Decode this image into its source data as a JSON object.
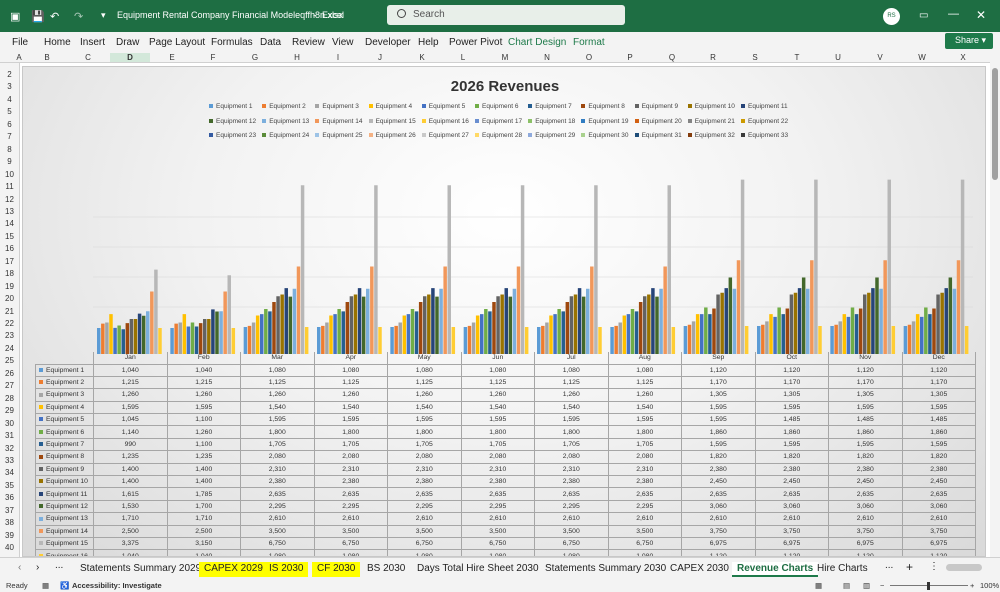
{
  "titlebar": {
    "file_name": "Equipment Rental Company Financial Modeleqffh8n.xlsx",
    "app_name": "Excel",
    "search_placeholder": "Search",
    "user_initials": "RS",
    "ribbon_display_icon": "ribbon-display-options-icon",
    "minimize_icon": "minimize-icon",
    "restore_icon": "restore-icon",
    "close_icon": "close-icon"
  },
  "menu": {
    "items": [
      "File",
      "Home",
      "Insert",
      "Draw",
      "Page Layout",
      "Formulas",
      "Data",
      "Review",
      "View",
      "Developer",
      "Help",
      "Power Pivot"
    ],
    "context_items": [
      "Chart Design",
      "Format"
    ],
    "share_label": "Share"
  },
  "columns": [
    "A",
    "B",
    "C",
    "D",
    "E",
    "F",
    "G",
    "H",
    "I",
    "J",
    "K",
    "L",
    "M",
    "N",
    "O",
    "P",
    "Q",
    "R",
    "S",
    "T",
    "U",
    "V",
    "W",
    "X"
  ],
  "rows": [
    "2",
    "3",
    "4",
    "5",
    "6",
    "7",
    "8",
    "9",
    "10",
    "11",
    "12",
    "13",
    "14",
    "15",
    "16",
    "17",
    "18",
    "19",
    "20",
    "21",
    "22",
    "23",
    "24",
    "25",
    "26",
    "27",
    "28",
    "29",
    "30",
    "31",
    "32",
    "33",
    "34",
    "35",
    "36",
    "37",
    "38",
    "39",
    "40"
  ],
  "chart_data": {
    "type": "bar",
    "title": "2026 Revenues",
    "legend_position": "top",
    "categories": [
      "Jan",
      "Feb",
      "Mar",
      "Apr",
      "May",
      "Jun",
      "Jul",
      "Aug",
      "Sep",
      "Oct",
      "Nov",
      "Dec"
    ],
    "series_colors": [
      "#5b9bd5",
      "#ed7d31",
      "#a5a5a5",
      "#ffc000",
      "#4472c4",
      "#70ad47",
      "#255e91",
      "#9e480e",
      "#636363",
      "#997300",
      "#264478",
      "#43682b",
      "#7cafdd",
      "#f1975a",
      "#b7b7b7",
      "#ffcd33",
      "#698ed0",
      "#8cc168",
      "#327dc2",
      "#d26012",
      "#848484",
      "#cc9a00",
      "#335aa1",
      "#5a8b39",
      "#9dc3e6",
      "#f4b183",
      "#c9c9c9",
      "#ffd966",
      "#8faadc",
      "#a9d18e",
      "#1f4e79",
      "#843c0c",
      "#3a3a3a"
    ],
    "series": [
      {
        "name": "Equipment 1",
        "values": [
          1040,
          1040,
          1080,
          1080,
          1080,
          1080,
          1080,
          1080,
          1120,
          1120,
          1120,
          1120
        ]
      },
      {
        "name": "Equipment 2",
        "values": [
          1215,
          1215,
          1125,
          1125,
          1125,
          1125,
          1125,
          1125,
          1170,
          1170,
          1170,
          1170
        ]
      },
      {
        "name": "Equipment 3",
        "values": [
          1260,
          1260,
          1260,
          1260,
          1260,
          1260,
          1260,
          1260,
          1305,
          1305,
          1305,
          1305
        ]
      },
      {
        "name": "Equipment 4",
        "values": [
          1595,
          1595,
          1540,
          1540,
          1540,
          1540,
          1540,
          1540,
          1595,
          1595,
          1595,
          1595
        ]
      },
      {
        "name": "Equipment 5",
        "values": [
          1045,
          1100,
          1595,
          1595,
          1595,
          1595,
          1595,
          1595,
          1595,
          1485,
          1485,
          1485
        ]
      },
      {
        "name": "Equipment 6",
        "values": [
          1140,
          1260,
          1800,
          1800,
          1800,
          1800,
          1800,
          1800,
          1860,
          1860,
          1860,
          1860
        ]
      },
      {
        "name": "Equipment 7",
        "values": [
          990,
          1100,
          1705,
          1705,
          1705,
          1705,
          1705,
          1705,
          1595,
          1595,
          1595,
          1595
        ]
      },
      {
        "name": "Equipment 8",
        "values": [
          1235,
          1235,
          2080,
          2080,
          2080,
          2080,
          2080,
          2080,
          1820,
          1820,
          1820,
          1820
        ]
      },
      {
        "name": "Equipment 9",
        "values": [
          1400,
          1400,
          2310,
          2310,
          2310,
          2310,
          2310,
          2310,
          2380,
          2380,
          2380,
          2380
        ]
      },
      {
        "name": "Equipment 10",
        "values": [
          1400,
          1400,
          2380,
          2380,
          2380,
          2380,
          2380,
          2380,
          2450,
          2450,
          2450,
          2450
        ]
      },
      {
        "name": "Equipment 11",
        "values": [
          1615,
          1785,
          2635,
          2635,
          2635,
          2635,
          2635,
          2635,
          2635,
          2635,
          2635,
          2635
        ]
      },
      {
        "name": "Equipment 12",
        "values": [
          1530,
          1700,
          2295,
          2295,
          2295,
          2295,
          2295,
          2295,
          3060,
          3060,
          3060,
          3060
        ]
      },
      {
        "name": "Equipment 13",
        "values": [
          1710,
          1710,
          2610,
          2610,
          2610,
          2610,
          2610,
          2610,
          2610,
          2610,
          2610,
          2610
        ]
      },
      {
        "name": "Equipment 14",
        "values": [
          2500,
          2500,
          3500,
          3500,
          3500,
          3500,
          3500,
          3500,
          3750,
          3750,
          3750,
          3750
        ]
      },
      {
        "name": "Equipment 15",
        "values": [
          3375,
          3150,
          6750,
          6750,
          6750,
          6750,
          6750,
          6750,
          6975,
          6975,
          6975,
          6975
        ]
      },
      {
        "name": "Equipment 16",
        "values": [
          1040,
          1040,
          1080,
          1080,
          1080,
          1080,
          1080,
          1080,
          1120,
          1120,
          1120,
          1120
        ]
      }
    ]
  },
  "sheet_tabs": {
    "prev_icon": "chevron-left-icon",
    "next_icon": "chevron-right-icon",
    "more_left": "...",
    "items": [
      {
        "label": "Statements Summary 2029",
        "style": "normal"
      },
      {
        "label": "CAPEX 2029",
        "style": "yellow"
      },
      {
        "label": "IS 2030",
        "style": "yellow"
      },
      {
        "label": "CF 2030",
        "style": "yellow"
      },
      {
        "label": "BS 2030",
        "style": "normal"
      },
      {
        "label": "Days Total Hire Sheet 2030",
        "style": "normal"
      },
      {
        "label": "Statements Summary 2030",
        "style": "normal"
      },
      {
        "label": "CAPEX 2030",
        "style": "normal"
      },
      {
        "label": "Revenue Charts",
        "style": "active"
      },
      {
        "label": "Hire Charts",
        "style": "normal"
      }
    ],
    "more_right": "...",
    "add_sheet": "+",
    "options": "⋮"
  },
  "status": {
    "ready": "Ready",
    "accessibility": "Accessibility: Investigate",
    "zoom": "100%"
  }
}
